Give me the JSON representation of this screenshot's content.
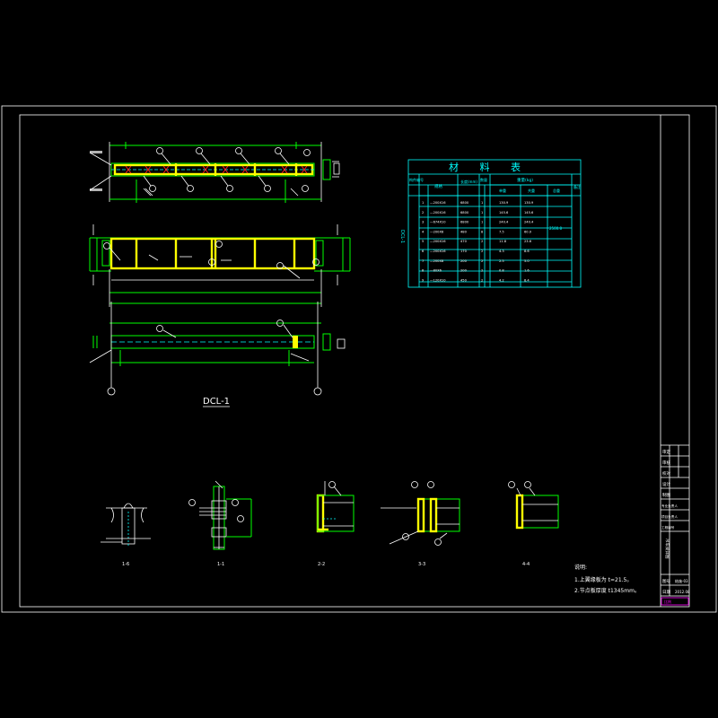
{
  "drawing": {
    "beam_label": "DCL-1",
    "section_labels": [
      "1-6",
      "1-1",
      "2-2",
      "3-3",
      "4-4"
    ],
    "notes_title": "说明:",
    "notes": [
      "1.上翼缘板为 t=21.5。",
      "2.节点板厚度 t1345mm。"
    ]
  },
  "material_table": {
    "title": "材 料 表",
    "headers": [
      "构件编号",
      "规格",
      "长度(mm)",
      "数量",
      "重量(kg)",
      "单重",
      "共重",
      "总重",
      "备注"
    ],
    "member": "DCL-1",
    "total": "2500.8",
    "rows": [
      {
        "no": "1",
        "spec": "—200X16",
        "len": "6800",
        "qty": "1",
        "unit": "130.9",
        "sum": "130.9"
      },
      {
        "no": "2",
        "spec": "—200X16",
        "len": "6800",
        "qty": "1",
        "unit": "145.6",
        "sum": "145.6"
      },
      {
        "no": "3",
        "spec": "—674X10",
        "len": "6800",
        "qty": "1",
        "unit": "240.4",
        "sum": "240.4"
      },
      {
        "no": "4",
        "spec": "—200X8",
        "len": "480",
        "qty": "8",
        "unit": "7.5",
        "sum": "60.0"
      },
      {
        "no": "5",
        "spec": "—200X16",
        "len": "470",
        "qty": "2",
        "unit": "11.8",
        "sum": "23.6"
      },
      {
        "no": "6",
        "spec": "—200X16",
        "len": "170",
        "qty": "2",
        "unit": "4.3",
        "sum": "8.6"
      },
      {
        "no": "7",
        "spec": "—200X8",
        "len": "200",
        "qty": "2",
        "unit": "2.5",
        "sum": "5.0"
      },
      {
        "no": "8",
        "spec": "—80X6",
        "len": "200",
        "qty": "2",
        "unit": "0.8",
        "sum": "1.6"
      },
      {
        "no": "9",
        "spec": "—120X10",
        "len": "450",
        "qty": "2",
        "unit": "4.2",
        "sum": "8.4"
      }
    ]
  },
  "title_block": {
    "rows": [
      "审定",
      "审核",
      "校对",
      "设计",
      "制图",
      "专业负责人",
      "项目负责人",
      "工程编号",
      "图号",
      "日期"
    ],
    "values": [
      "",
      "",
      "",
      "",
      "",
      "",
      "",
      "",
      "",
      ""
    ],
    "drawing_name": "吊车梁详图",
    "sheet": "结施-03",
    "date": "2012.08",
    "scale_label": "比例"
  },
  "colors": {
    "frame": "#ffffff",
    "green": "#00ff00",
    "yellow": "#ffff00",
    "cyan": "#00ffff",
    "red": "#ff2020",
    "magenta": "#ff00ff"
  }
}
